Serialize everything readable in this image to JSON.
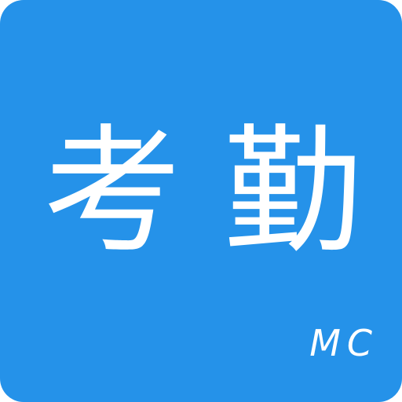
{
  "icon": {
    "background_color": "#2592E9",
    "title_char_1": "考",
    "title_char_2": "勤",
    "badge": "MC",
    "text_color": "#FFFFFF"
  }
}
